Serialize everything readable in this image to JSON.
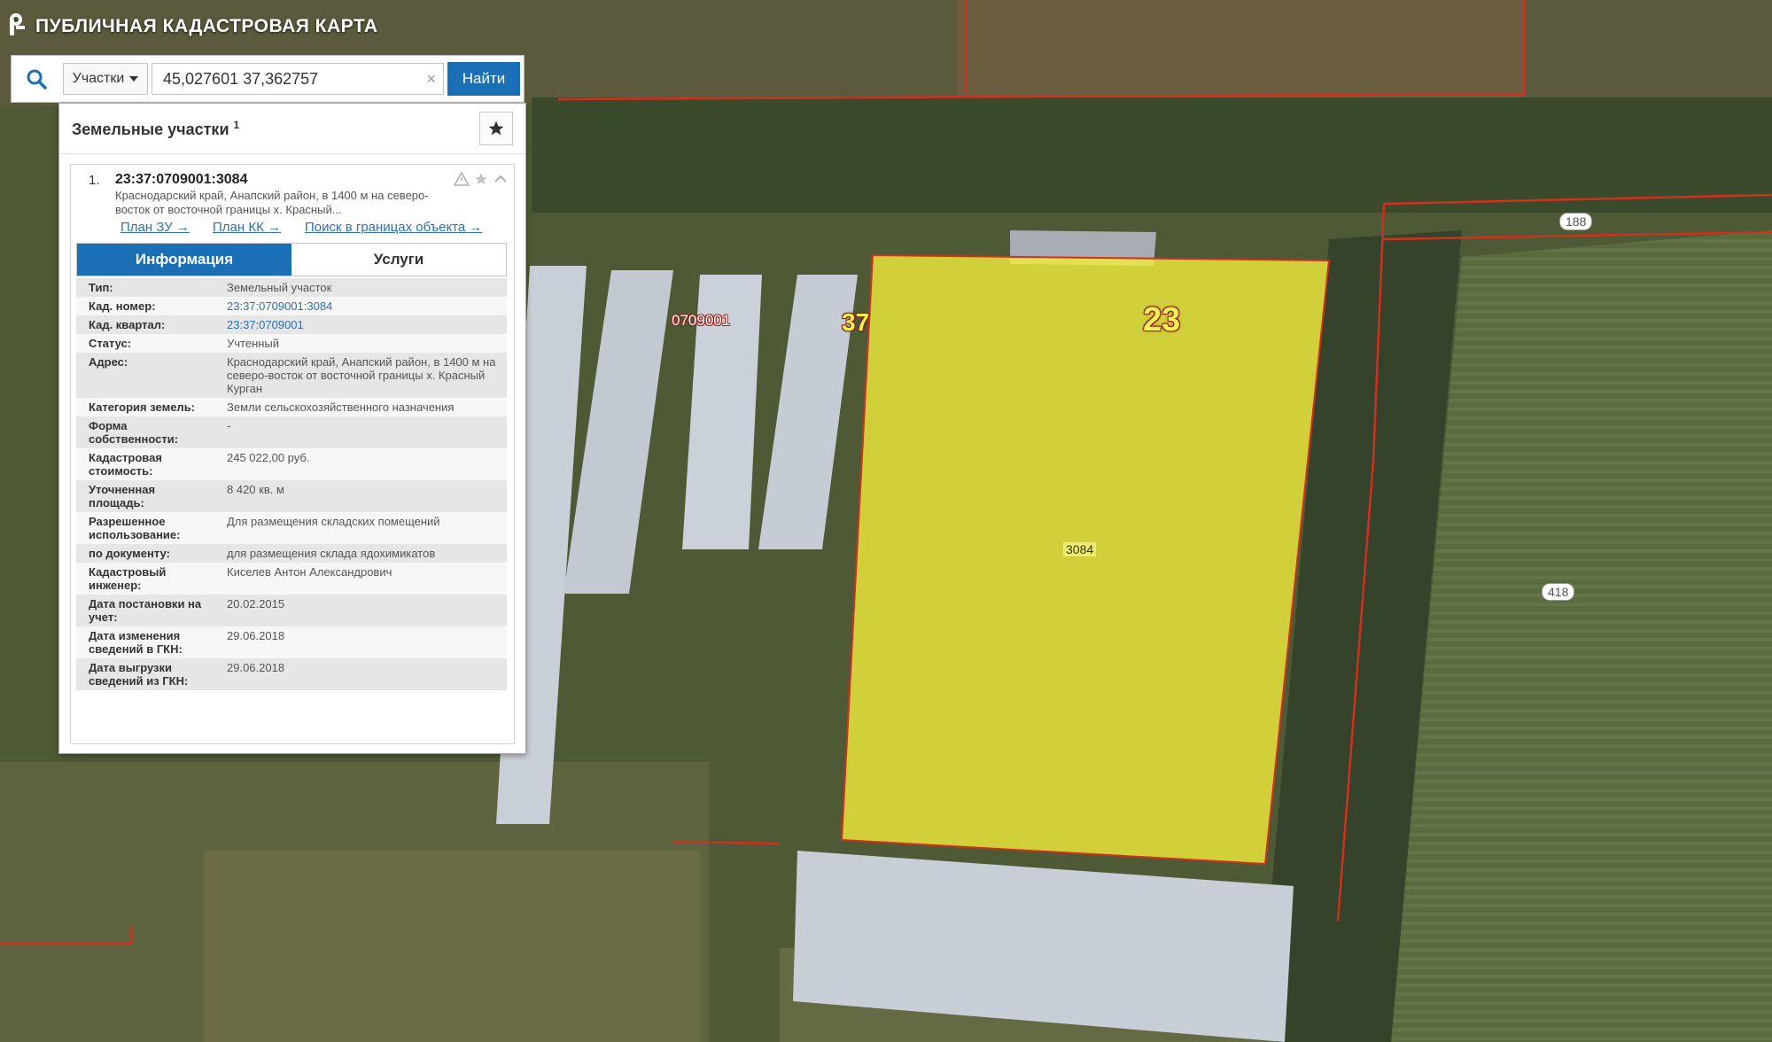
{
  "app": {
    "title": "ПУБЛИЧНАЯ КАДАСТРОВАЯ КАРТА"
  },
  "search": {
    "layer_selected": "Участки",
    "value": "45,027601 37,362757",
    "button_label": "Найти",
    "clear_symbol": "×"
  },
  "panel": {
    "title": "Земельные участки",
    "count": "1"
  },
  "result": {
    "index": "1.",
    "cadastral_number": "23:37:0709001:3084",
    "description": "Краснодарский край, Анапский район, в 1400 м на северо-восток от восточной границы х. Красный...",
    "links": {
      "plan_zu": "План ЗУ →",
      "plan_kk": "План КК →",
      "search_in_bounds": "Поиск в границах объекта →"
    }
  },
  "tabs": {
    "info": "Информация",
    "services": "Услуги"
  },
  "info_rows": [
    {
      "key": "Тип:",
      "value": "Земельный участок"
    },
    {
      "key": "Кад. номер:",
      "value": "23:37:0709001:3084"
    },
    {
      "key": "Кад. квартал:",
      "value": "23:37:0709001"
    },
    {
      "key": "Статус:",
      "value": "Учтенный"
    },
    {
      "key": "Адрес:",
      "value": "Краснодарский край, Анапский район, в 1400 м на северо-восток от восточной границы х. Красный Курган"
    },
    {
      "key": "Категория земель:",
      "value": "Земли сельскохозяйственного назначения"
    },
    {
      "key": "Форма собственности:",
      "value": "-"
    },
    {
      "key": "Кадастровая стоимость:",
      "value": "245 022,00 руб."
    },
    {
      "key": "Уточненная площадь:",
      "value": "8 420 кв. м"
    },
    {
      "key": "Разрешенное использование:",
      "value": "Для размещения складских помещений"
    },
    {
      "key": "по документу:",
      "value": "для размещения склада ядохимикатов"
    },
    {
      "key": "Кадастровый инженер:",
      "value": "Киселев Антон Александрович"
    },
    {
      "key": "Дата постановки на учет:",
      "value": "20.02.2015"
    },
    {
      "key": "Дата изменения сведений в ГКН:",
      "value": "29.06.2018"
    },
    {
      "key": "Дата выгрузки сведений из ГКН:",
      "value": "29.06.2018"
    }
  ],
  "map": {
    "region_label": "23",
    "district_label": "37",
    "quarter_label": "0709001",
    "plot_label": "3084",
    "pill_labels": [
      "188",
      "418"
    ]
  },
  "colors": {
    "accent": "#1b6fb4",
    "plot_fill": "#f2ec3c",
    "boundary": "#d0301e"
  },
  "icons": {
    "search": "search-icon",
    "favorite": "star-icon",
    "logo": "pkk-logo"
  }
}
